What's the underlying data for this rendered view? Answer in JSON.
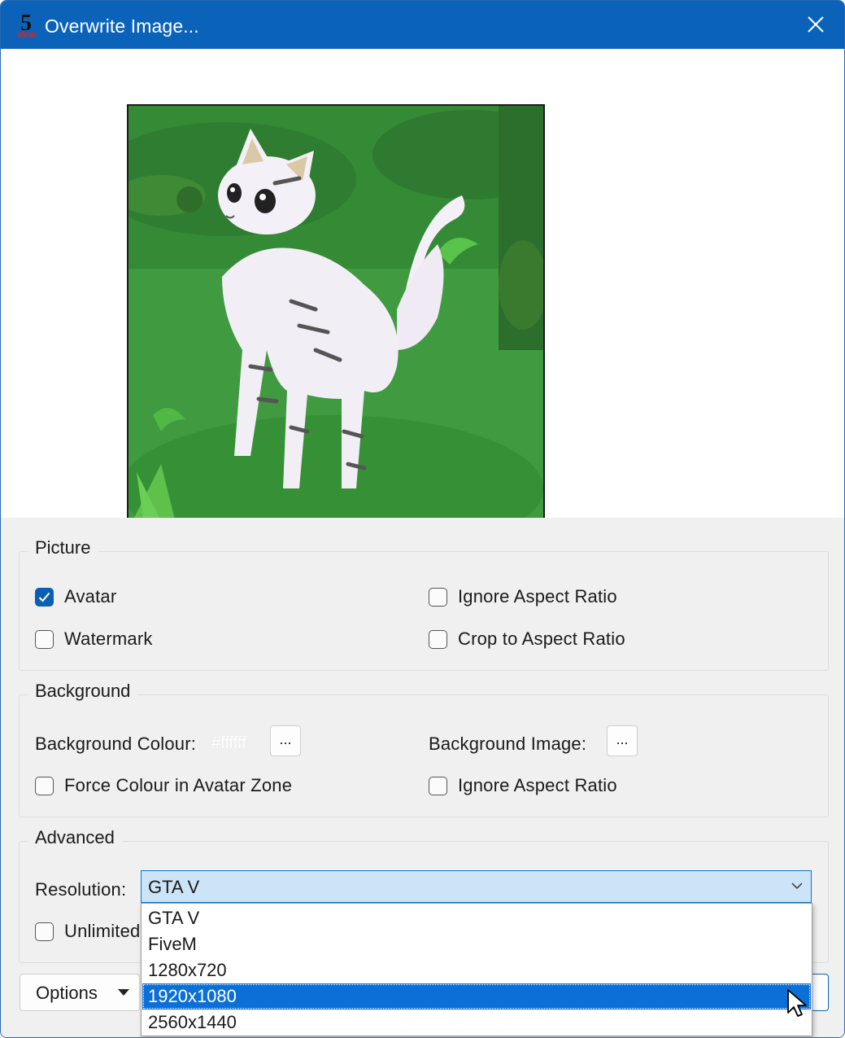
{
  "window": {
    "title": "Overwrite Image...",
    "accent_color": "#0a63b8",
    "icon": "5-view-app-icon",
    "icon_digit": "5",
    "icon_subtext": "VIEW"
  },
  "picture": {
    "group_label": "Picture",
    "avatar": {
      "label": "Avatar",
      "checked": true
    },
    "watermark": {
      "label": "Watermark",
      "checked": false
    },
    "ignore_aspect_ratio": {
      "label": "Ignore Aspect Ratio",
      "checked": false
    },
    "crop_to_aspect_ratio": {
      "label": "Crop to Aspect Ratio",
      "checked": false
    }
  },
  "background": {
    "group_label": "Background",
    "colour_label": "Background Colour:",
    "colour_value": "#ffffff",
    "colour_button": "...",
    "image_label": "Background Image:",
    "image_button": "...",
    "force_colour": {
      "label": "Force Colour in Avatar Zone",
      "checked": false
    },
    "ignore_aspect_ratio": {
      "label": "Ignore Aspect Ratio",
      "checked": false
    }
  },
  "advanced": {
    "group_label": "Advanced",
    "resolution_label": "Resolution:",
    "resolution_value": "GTA V",
    "resolution_options": [
      "GTA V",
      "FiveM",
      "1280x720",
      "1920x1080",
      "2560x1440"
    ],
    "highlighted_option": "1920x1080",
    "unlimited": {
      "label": "Unlimited",
      "checked": false
    }
  },
  "footer": {
    "options_label": "Options"
  }
}
